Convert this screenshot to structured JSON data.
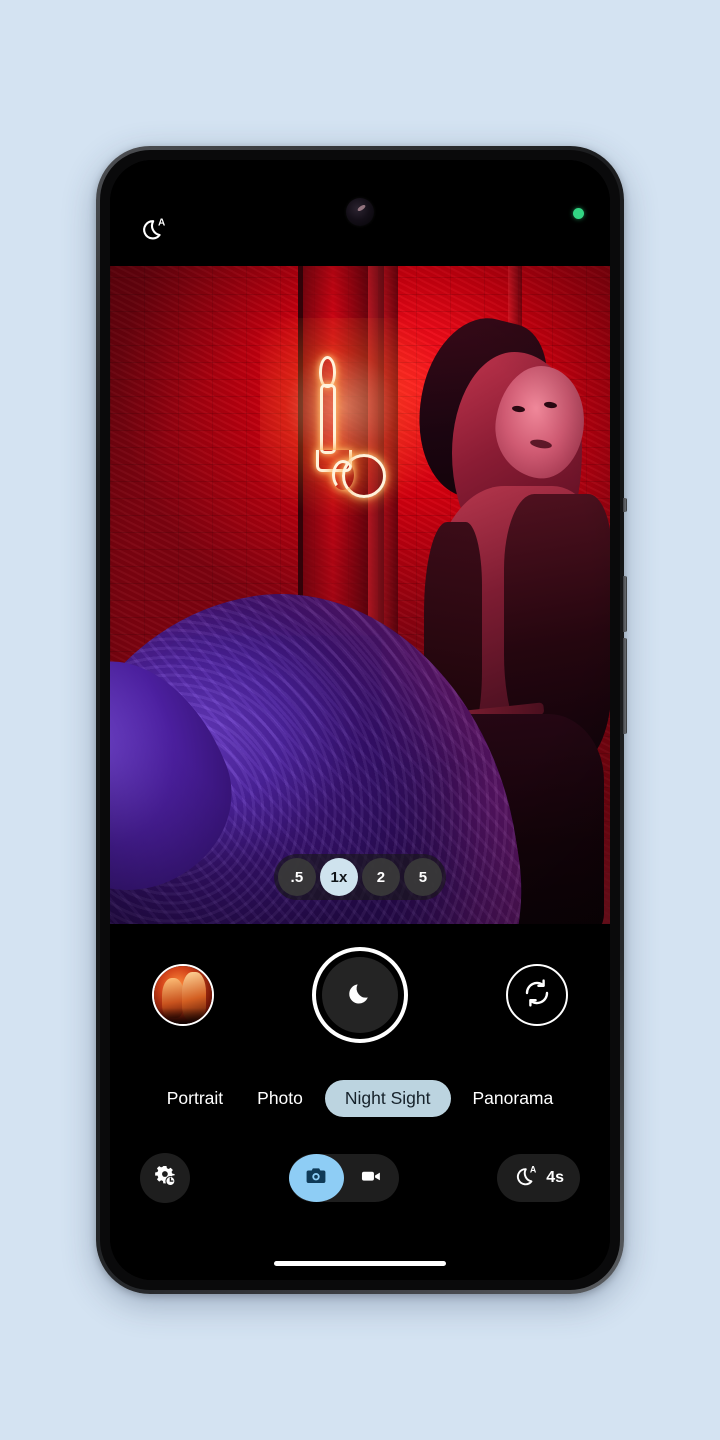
{
  "theme": {
    "page_background": "#d4e3f2",
    "screen_background": "#000000",
    "accent_blue": "#8ecdf5",
    "active_pill": "#bcd4e0",
    "privacy_dot": "#32d583"
  },
  "status_bar": {
    "night_mode_icon": "moon-auto-icon",
    "front_camera": "punch-hole-camera",
    "privacy_indicator": "camera-in-use-dot"
  },
  "viewfinder": {
    "scene_description": "Neon-lit red room with candle neon sign and two people",
    "zoom_selector": {
      "options": [
        {
          "label": ".5",
          "active": false
        },
        {
          "label": "1x",
          "active": true
        },
        {
          "label": "2",
          "active": false
        },
        {
          "label": "5",
          "active": false
        }
      ]
    }
  },
  "shutter_row": {
    "gallery_label": "gallery-thumbnail",
    "shutter_label": "shutter-button",
    "shutter_icon": "moon-icon",
    "flip_label": "flip-camera-button",
    "flip_icon": "camera-flip-icon"
  },
  "modes": [
    {
      "label": "Portrait",
      "active": false
    },
    {
      "label": "Photo",
      "active": false
    },
    {
      "label": "Night Sight",
      "active": true
    },
    {
      "label": "Panorama",
      "active": false
    }
  ],
  "bottom_bar": {
    "settings_icon": "settings-gear-timer-icon",
    "capture_toggle": {
      "photo": {
        "icon": "photo-camera-icon",
        "active": true
      },
      "video": {
        "icon": "video-camera-icon",
        "active": false
      }
    },
    "night_timer": {
      "icon": "moon-auto-icon",
      "value": "4s"
    }
  },
  "navigation": {
    "gesture_bar": "home-gesture-bar"
  }
}
